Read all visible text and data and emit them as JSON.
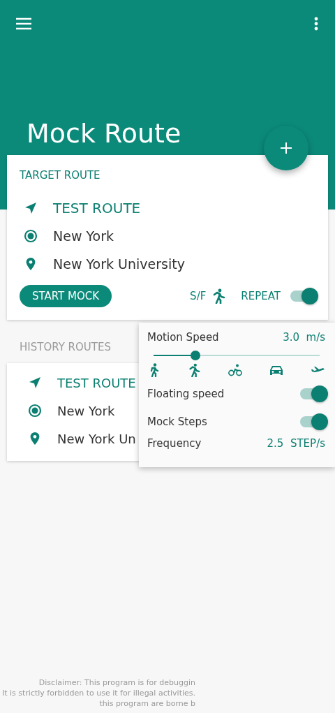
{
  "app_bar": {
    "title": "Mock Route"
  },
  "target_route": {
    "heading": "TARGET ROUTE",
    "name": "TEST ROUTE",
    "start": "New York",
    "end": "New York University",
    "start_button": "START MOCK",
    "sf_label": "S/F",
    "repeat_label": "REPEAT",
    "repeat_on": true
  },
  "history": {
    "heading": "HISTORY ROUTES",
    "routes": [
      {
        "name": "TEST ROUTE",
        "start": "New York",
        "end": "New York Un"
      }
    ]
  },
  "speed_panel": {
    "label": "Motion Speed",
    "value": "3.0",
    "unit": "m/s",
    "level": 0.25,
    "modes": [
      {
        "kind": "walk"
      },
      {
        "kind": "run"
      },
      {
        "kind": "bike"
      },
      {
        "kind": "car"
      },
      {
        "kind": "plane"
      }
    ],
    "toggles": [
      {
        "label": "Floating speed",
        "on": true
      },
      {
        "label": "Mock Steps",
        "on": true
      }
    ],
    "frequency": {
      "label": "Frequency",
      "value": "2.5",
      "unit": "STEP/s"
    }
  },
  "disclaimer": [
    "Disclaimer: This program is for debuggin",
    "It is strictly forbidden to use it for illegal activities.",
    "this program are borne b"
  ]
}
